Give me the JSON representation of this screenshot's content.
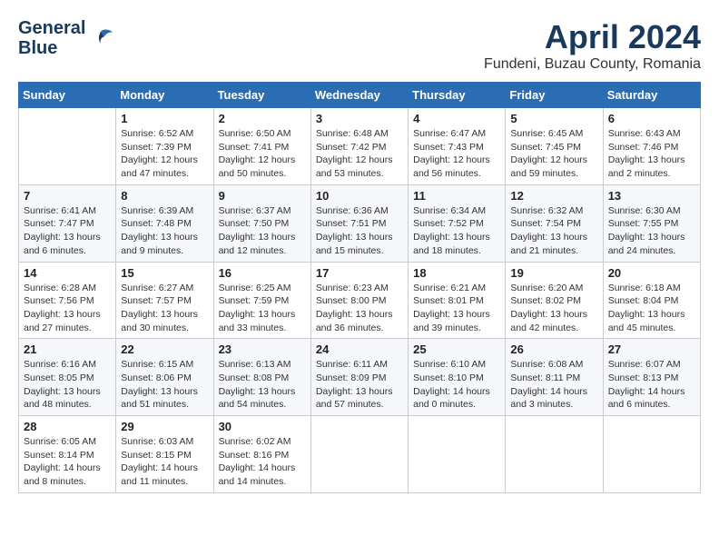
{
  "header": {
    "logo_line1": "General",
    "logo_line2": "Blue",
    "month_title": "April 2024",
    "location": "Fundeni, Buzau County, Romania"
  },
  "days_of_week": [
    "Sunday",
    "Monday",
    "Tuesday",
    "Wednesday",
    "Thursday",
    "Friday",
    "Saturday"
  ],
  "weeks": [
    [
      {
        "day": "",
        "info": ""
      },
      {
        "day": "1",
        "info": "Sunrise: 6:52 AM\nSunset: 7:39 PM\nDaylight: 12 hours\nand 47 minutes."
      },
      {
        "day": "2",
        "info": "Sunrise: 6:50 AM\nSunset: 7:41 PM\nDaylight: 12 hours\nand 50 minutes."
      },
      {
        "day": "3",
        "info": "Sunrise: 6:48 AM\nSunset: 7:42 PM\nDaylight: 12 hours\nand 53 minutes."
      },
      {
        "day": "4",
        "info": "Sunrise: 6:47 AM\nSunset: 7:43 PM\nDaylight: 12 hours\nand 56 minutes."
      },
      {
        "day": "5",
        "info": "Sunrise: 6:45 AM\nSunset: 7:45 PM\nDaylight: 12 hours\nand 59 minutes."
      },
      {
        "day": "6",
        "info": "Sunrise: 6:43 AM\nSunset: 7:46 PM\nDaylight: 13 hours\nand 2 minutes."
      }
    ],
    [
      {
        "day": "7",
        "info": "Sunrise: 6:41 AM\nSunset: 7:47 PM\nDaylight: 13 hours\nand 6 minutes."
      },
      {
        "day": "8",
        "info": "Sunrise: 6:39 AM\nSunset: 7:48 PM\nDaylight: 13 hours\nand 9 minutes."
      },
      {
        "day": "9",
        "info": "Sunrise: 6:37 AM\nSunset: 7:50 PM\nDaylight: 13 hours\nand 12 minutes."
      },
      {
        "day": "10",
        "info": "Sunrise: 6:36 AM\nSunset: 7:51 PM\nDaylight: 13 hours\nand 15 minutes."
      },
      {
        "day": "11",
        "info": "Sunrise: 6:34 AM\nSunset: 7:52 PM\nDaylight: 13 hours\nand 18 minutes."
      },
      {
        "day": "12",
        "info": "Sunrise: 6:32 AM\nSunset: 7:54 PM\nDaylight: 13 hours\nand 21 minutes."
      },
      {
        "day": "13",
        "info": "Sunrise: 6:30 AM\nSunset: 7:55 PM\nDaylight: 13 hours\nand 24 minutes."
      }
    ],
    [
      {
        "day": "14",
        "info": "Sunrise: 6:28 AM\nSunset: 7:56 PM\nDaylight: 13 hours\nand 27 minutes."
      },
      {
        "day": "15",
        "info": "Sunrise: 6:27 AM\nSunset: 7:57 PM\nDaylight: 13 hours\nand 30 minutes."
      },
      {
        "day": "16",
        "info": "Sunrise: 6:25 AM\nSunset: 7:59 PM\nDaylight: 13 hours\nand 33 minutes."
      },
      {
        "day": "17",
        "info": "Sunrise: 6:23 AM\nSunset: 8:00 PM\nDaylight: 13 hours\nand 36 minutes."
      },
      {
        "day": "18",
        "info": "Sunrise: 6:21 AM\nSunset: 8:01 PM\nDaylight: 13 hours\nand 39 minutes."
      },
      {
        "day": "19",
        "info": "Sunrise: 6:20 AM\nSunset: 8:02 PM\nDaylight: 13 hours\nand 42 minutes."
      },
      {
        "day": "20",
        "info": "Sunrise: 6:18 AM\nSunset: 8:04 PM\nDaylight: 13 hours\nand 45 minutes."
      }
    ],
    [
      {
        "day": "21",
        "info": "Sunrise: 6:16 AM\nSunset: 8:05 PM\nDaylight: 13 hours\nand 48 minutes."
      },
      {
        "day": "22",
        "info": "Sunrise: 6:15 AM\nSunset: 8:06 PM\nDaylight: 13 hours\nand 51 minutes."
      },
      {
        "day": "23",
        "info": "Sunrise: 6:13 AM\nSunset: 8:08 PM\nDaylight: 13 hours\nand 54 minutes."
      },
      {
        "day": "24",
        "info": "Sunrise: 6:11 AM\nSunset: 8:09 PM\nDaylight: 13 hours\nand 57 minutes."
      },
      {
        "day": "25",
        "info": "Sunrise: 6:10 AM\nSunset: 8:10 PM\nDaylight: 14 hours\nand 0 minutes."
      },
      {
        "day": "26",
        "info": "Sunrise: 6:08 AM\nSunset: 8:11 PM\nDaylight: 14 hours\nand 3 minutes."
      },
      {
        "day": "27",
        "info": "Sunrise: 6:07 AM\nSunset: 8:13 PM\nDaylight: 14 hours\nand 6 minutes."
      }
    ],
    [
      {
        "day": "28",
        "info": "Sunrise: 6:05 AM\nSunset: 8:14 PM\nDaylight: 14 hours\nand 8 minutes."
      },
      {
        "day": "29",
        "info": "Sunrise: 6:03 AM\nSunset: 8:15 PM\nDaylight: 14 hours\nand 11 minutes."
      },
      {
        "day": "30",
        "info": "Sunrise: 6:02 AM\nSunset: 8:16 PM\nDaylight: 14 hours\nand 14 minutes."
      },
      {
        "day": "",
        "info": ""
      },
      {
        "day": "",
        "info": ""
      },
      {
        "day": "",
        "info": ""
      },
      {
        "day": "",
        "info": ""
      }
    ]
  ]
}
